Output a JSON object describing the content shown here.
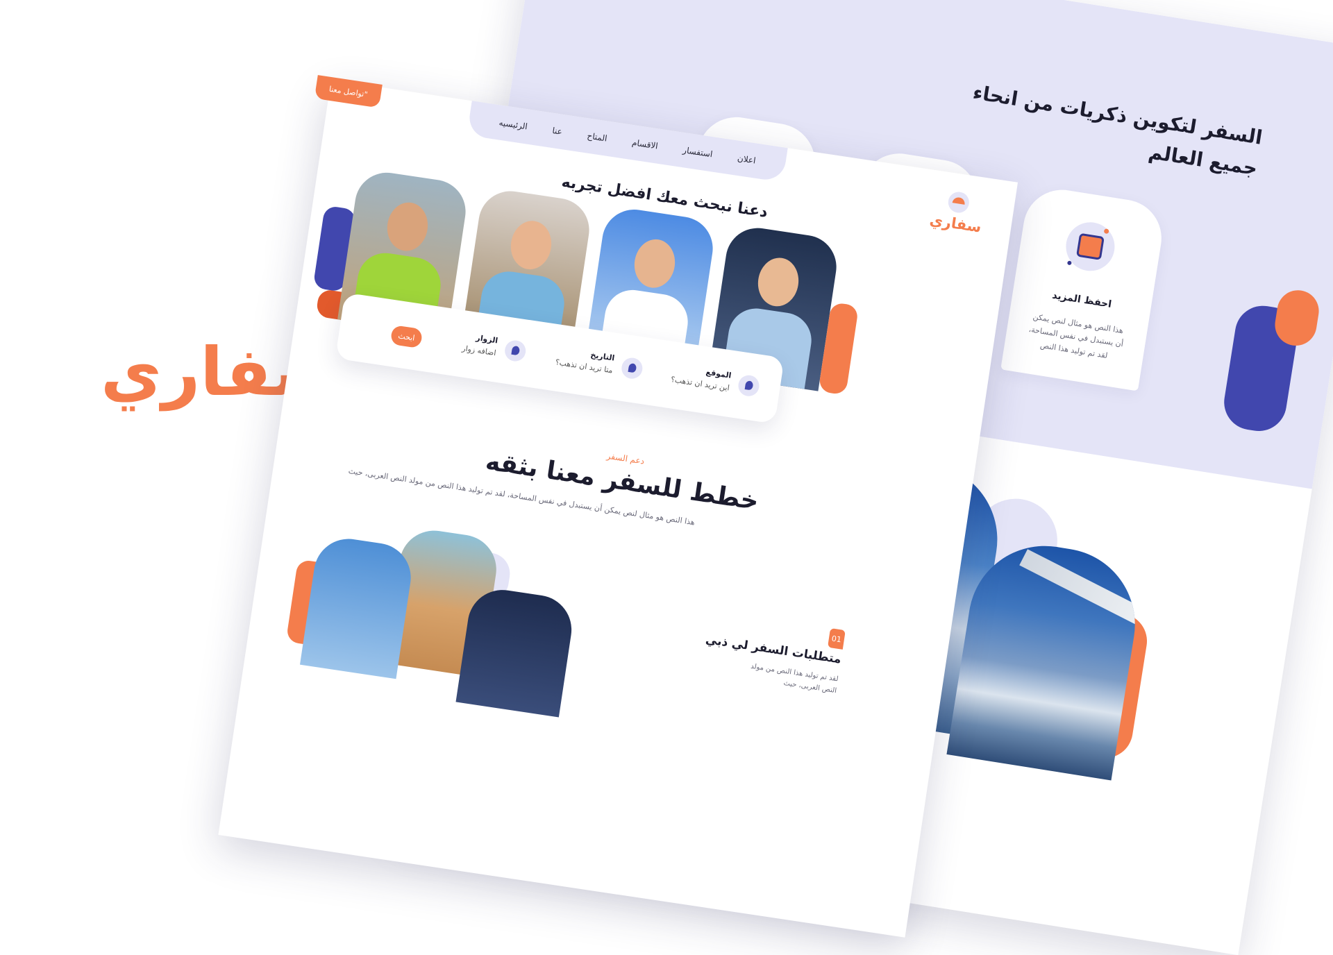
{
  "brand": {
    "wordmark": "سفاري"
  },
  "back_page": {
    "title": "السفر لتكوين ذكريات من انحاء جميع العالم",
    "feature": {
      "title": "احفظ المزيد",
      "description": "هذا النص هو مثال لنص يمكن أن يستبدل في نفس المساحة، لقد تم توليد هذا النص"
    }
  },
  "front_page": {
    "logo_text": "سفاري",
    "nav": [
      "الرئيسيه",
      "عنا",
      "المتاح",
      "الاقسام",
      "استفسار",
      "اعلان"
    ],
    "contact_button": "تواصل معنا\"",
    "hero_title": "دعنا نبحث معك افضل تجربه",
    "search": {
      "location_label": "الموقع",
      "location_sub": "اين تريد ان تذهب؟",
      "date_label": "التاريخ",
      "date_sub": "متا تريد ان تذهب؟",
      "guests_label": "الزوار",
      "guests_sub": "اضافه زوار",
      "button": "ابحث"
    },
    "section": {
      "label": "دعم السفر",
      "title": "خطط للسفر معنا بثقه",
      "description": "هذا النص هو مثال لنص يمكن أن يستبدل في نفس المساحة، لقد تم توليد هذا النص من مولد النص العربى، حيث"
    },
    "step": {
      "number": "01",
      "title": "متطلبات السفر لي ذبي",
      "description": "لقد تم توليد هذا النص من مولد النص العربى، حيث"
    }
  },
  "colors": {
    "accent": "#f47d4c",
    "primary": "#4147ae",
    "lavender": "#e4e4f7"
  }
}
